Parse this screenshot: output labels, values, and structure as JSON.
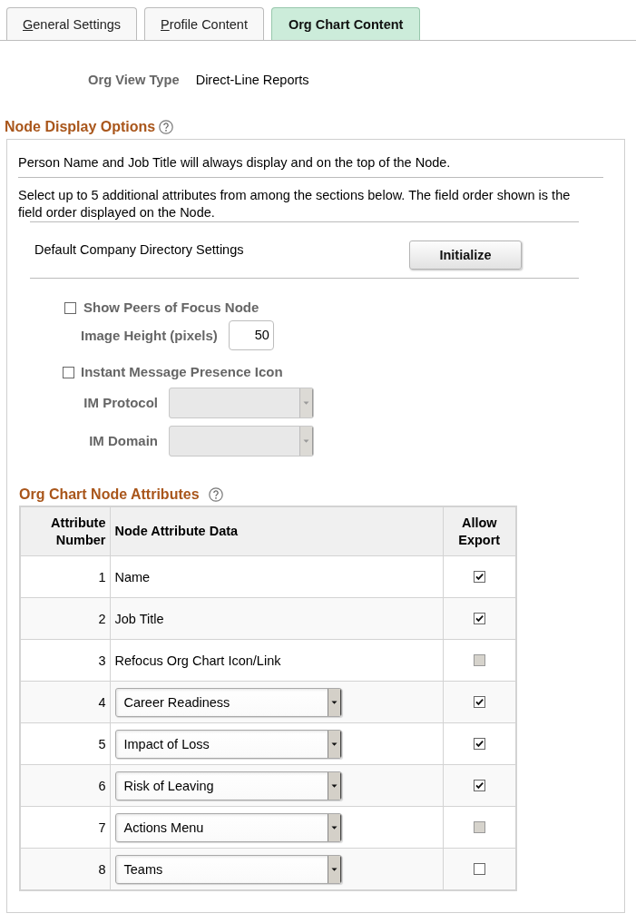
{
  "tabs": [
    {
      "label": "General Settings",
      "selected": false,
      "mnemonic": true
    },
    {
      "label": "Profile Content",
      "selected": false,
      "mnemonic": true
    },
    {
      "label": "Org Chart Content",
      "selected": true,
      "mnemonic": false
    }
  ],
  "org_view_type": {
    "label": "Org View Type",
    "value": "Direct-Line Reports"
  },
  "node_display_options": {
    "title": "Node Display Options",
    "notes": [
      "Person Name and Job Title will always display and on the top of the Node.",
      "Select up to 5 additional attributes from among the sections below. The field order shown is the field order displayed on the Node."
    ],
    "default_settings": {
      "label": "Default Company Directory Settings",
      "button": "Initialize"
    },
    "show_peers": {
      "label": "Show Peers of Focus Node",
      "checked": false
    },
    "image_height": {
      "label": "Image Height (pixels)",
      "value": "50"
    },
    "im_presence": {
      "label": "Instant Message Presence Icon",
      "checked": false
    },
    "im_protocol": {
      "label": "IM Protocol",
      "disabled": true
    },
    "im_domain": {
      "label": "IM Domain",
      "disabled": true
    }
  },
  "attributes": {
    "title": "Org Chart Node Attributes",
    "columns": [
      "Attribute Number",
      "Node Attribute Data",
      "Allow Export"
    ],
    "rows": [
      {
        "number": "1",
        "kind": "text",
        "value": "Name",
        "allow_export": {
          "checked": true,
          "disabled": false
        }
      },
      {
        "number": "2",
        "kind": "text",
        "value": "Job Title",
        "allow_export": {
          "checked": true,
          "disabled": false
        }
      },
      {
        "number": "3",
        "kind": "text",
        "value": "Refocus Org Chart Icon/Link",
        "allow_export": {
          "checked": false,
          "disabled": true
        }
      },
      {
        "number": "4",
        "kind": "select",
        "value": "Career Readiness",
        "allow_export": {
          "checked": true,
          "disabled": false
        }
      },
      {
        "number": "5",
        "kind": "select",
        "value": "Impact of Loss",
        "allow_export": {
          "checked": true,
          "disabled": false
        }
      },
      {
        "number": "6",
        "kind": "select",
        "value": "Risk of Leaving",
        "allow_export": {
          "checked": true,
          "disabled": false
        }
      },
      {
        "number": "7",
        "kind": "select",
        "value": "Actions Menu",
        "allow_export": {
          "checked": false,
          "disabled": true
        }
      },
      {
        "number": "8",
        "kind": "select",
        "value": "Teams",
        "allow_export": {
          "checked": false,
          "disabled": false
        }
      }
    ]
  }
}
